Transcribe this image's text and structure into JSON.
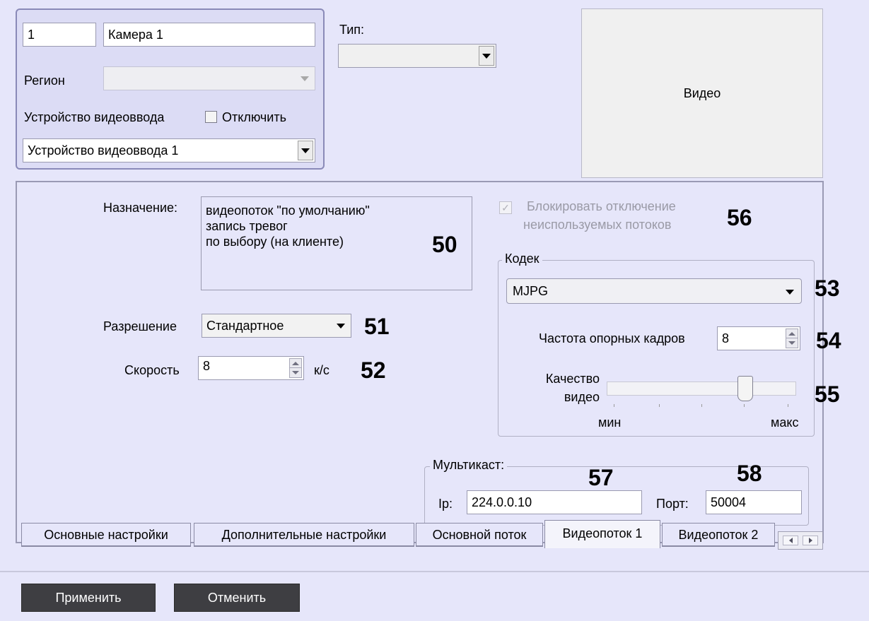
{
  "camera": {
    "id": "1",
    "name": "Камера 1",
    "region_label": "Регион",
    "region_value": "",
    "device_label": "Устройство видеоввода",
    "disable_label": "Отключить",
    "device_value": "Устройство видеоввода 1"
  },
  "type": {
    "label": "Тип:",
    "value": ""
  },
  "video_panel": {
    "label": "Видео"
  },
  "stream": {
    "purpose_label": "Назначение:",
    "purpose_lines": [
      "видеопоток \"по умолчанию\"",
      "запись тревог",
      "по выбору (на клиенте)"
    ],
    "resolution_label": "Разрешение",
    "resolution_value": "Стандартное",
    "speed_label": "Скорость",
    "speed_value": "8",
    "speed_unit": "к/с",
    "block_label_line1": "Блокировать отключение",
    "block_label_line2": "неиспользуемых потоков",
    "block_checked": true
  },
  "codec": {
    "group_title": "Кодек",
    "value": "MJPG",
    "keyframe_label": "Частота опорных кадров",
    "keyframe_value": "8",
    "quality_label_line1": "Качество",
    "quality_label_line2": "видео",
    "quality_min": "мин",
    "quality_max": "макс",
    "quality_level": 0.75
  },
  "multicast": {
    "group_title": "Мультикаст:",
    "ip_label": "Ip:",
    "ip_value": "224.0.0.10",
    "port_label": "Порт:",
    "port_value": "50004"
  },
  "callouts": [
    "50",
    "51",
    "52",
    "53",
    "54",
    "55",
    "56",
    "57",
    "58"
  ],
  "tabs": [
    "Основные настройки",
    "Дополнительные настройки",
    "Основной поток",
    "Видеопоток 1",
    "Видеопоток 2"
  ],
  "active_tab": "Видеопоток 1",
  "buttons": {
    "apply": "Применить",
    "cancel": "Отменить"
  }
}
